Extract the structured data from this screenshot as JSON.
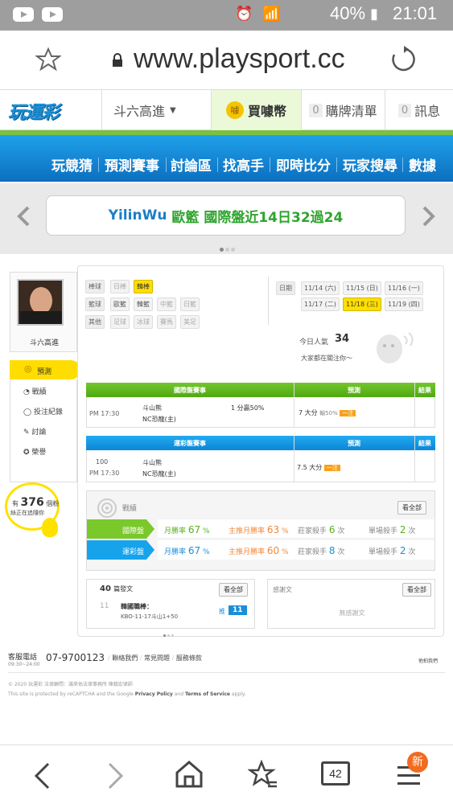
{
  "status_bar": {
    "battery": "40%",
    "time": "21:01"
  },
  "browser": {
    "url": "www.playsport.cc",
    "tabs_count": "42",
    "menu_badge": "新"
  },
  "site_header": {
    "logo": "玩運彩",
    "user_menu": "斗六高進",
    "buy_coins": "買噱幣",
    "coin_label": "噱",
    "list_count": "0",
    "list_label": "購牌清單",
    "msg_count": "0",
    "msg_label": "訊息"
  },
  "nav": [
    "玩競猜",
    "預測賽事",
    "討論區",
    "找高手",
    "即時比分",
    "玩家搜尋",
    "數據"
  ],
  "promo": {
    "name": "YilinWu",
    "text": "歐籃 國際盤近14日32過24"
  },
  "profile": {
    "name": "斗六高進"
  },
  "side_menu": [
    {
      "label": "預測",
      "active": true
    },
    {
      "label": "戰績"
    },
    {
      "label": "投注紀錄"
    },
    {
      "label": "討論"
    },
    {
      "label": "榮譽"
    }
  ],
  "followers": {
    "prefix": "有",
    "count": "376",
    "suffix": "個粉",
    "line2": "絲正在追隨你"
  },
  "sports": {
    "baseball": {
      "label": "棒球",
      "items": [
        "日棒",
        "韓棒"
      ]
    },
    "basketball": {
      "label": "籃球",
      "items": [
        "歐籃",
        "韓籃",
        "中籃",
        "日籃"
      ]
    },
    "other": {
      "label": "其他",
      "items": [
        "足球",
        "冰球",
        "賽馬",
        "美足"
      ]
    }
  },
  "dates": {
    "label": "日期",
    "items": [
      "11/14 (六)",
      "11/15 (日)",
      "11/16 (一)",
      "11/17 (二)",
      "11/18 (三)",
      "11/19 (四)"
    ]
  },
  "popularity": {
    "label": "今日人氣",
    "value": "34",
    "caption": "大家都在關注你～"
  },
  "intl_table": {
    "headers": [
      "國際盤賽事",
      "預測",
      "結果"
    ],
    "time": "PM 17:30",
    "team1": "斗山熊",
    "team2": "NC恐龍(主)",
    "line": "1 分贏50%",
    "pick": "7 大分",
    "pick_extra": "輸50%",
    "badge": "一注"
  },
  "lottery_table": {
    "headers": [
      "運彩盤賽事",
      "預測",
      "結果"
    ],
    "no": "100",
    "time": "PM 17:30",
    "team1": "斗山熊",
    "team2": "NC恐龍(主)",
    "pick": "7.5 大分",
    "badge": "一注"
  },
  "record": {
    "title": "戰績",
    "view_all": "看全部",
    "rows": [
      {
        "tag": "國際盤",
        "month_label": "月勝率",
        "month_val": "67",
        "pct": "%",
        "main_label": "主推月勝率",
        "main_val": "63",
        "house_label": "莊家殺手",
        "house_val": "6",
        "times": "次",
        "single_label": "單場殺手",
        "single_val": "2"
      },
      {
        "tag": "運彩盤",
        "month_label": "月勝率",
        "month_val": "67",
        "pct": "%",
        "main_label": "主推月勝率",
        "main_val": "60",
        "house_label": "莊家殺手",
        "house_val": "8",
        "times": "次",
        "single_label": "單場殺手",
        "single_val": "2"
      }
    ]
  },
  "posts": {
    "count": "40",
    "label": "篇發文",
    "view_all": "看全部",
    "post_no": "11",
    "post_title": "韓國職棒：",
    "post_desc": "KBO-11-17斗山1+50",
    "reply_label": "推",
    "reply_count": "11"
  },
  "thanks": {
    "title": "感謝文",
    "view_all": "看全部",
    "empty": "無感謝文"
  },
  "footer": {
    "service_label": "客服電話",
    "service_hours": "09:30~24:00",
    "phone": "07-9700123",
    "links": [
      "聯絡我們",
      "常見問題",
      "服務條款"
    ],
    "right_link": "他拍我們",
    "copyright": "© 2020 玩運彩 法律顧問：滿來佑法律事務所 陳鎮宏律師",
    "recaptcha_pre": "This site is protected by reCAPTCHA and the Google",
    "privacy": "Privacy Policy",
    "and": "and",
    "terms": "Terms of Service",
    "apply": "apply."
  }
}
